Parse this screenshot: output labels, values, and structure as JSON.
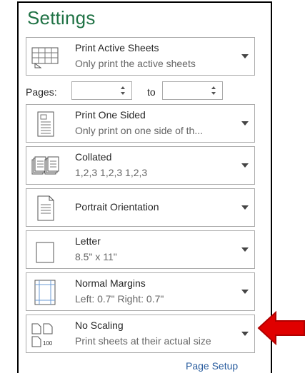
{
  "settings": {
    "title": "Settings",
    "cards": [
      {
        "id": "print-active-sheets",
        "line1": "Print Active Sheets",
        "line2": "Only print the active sheets"
      },
      {
        "id": "print-one-sided",
        "line1": "Print One Sided",
        "line2": "Only print on one side of th..."
      },
      {
        "id": "collated",
        "line1": "Collated",
        "line2": "1,2,3   1,2,3   1,2,3"
      },
      {
        "id": "portrait-orientation",
        "line1": "Portrait Orientation"
      },
      {
        "id": "letter",
        "line1": "Letter",
        "line2": "8.5\" x 11\""
      },
      {
        "id": "normal-margins",
        "line1": "Normal Margins",
        "line2": "Left:  0.7\"    Right:  0.7\""
      },
      {
        "id": "no-scaling",
        "line1": "No Scaling",
        "line2": "Print sheets at their actual size"
      }
    ],
    "pages_label": "Pages:",
    "to_label": "to",
    "pages_from": "",
    "pages_to": "",
    "page_setup_link": "Page Setup"
  },
  "colors": {
    "title": "#217346",
    "link": "#2a5d9f",
    "annotation_arrow": "#e00000"
  },
  "icons": [
    "sheet-grid-icon",
    "one-sided-page-icon",
    "collated-pages-icon",
    "portrait-page-icon",
    "letter-page-icon",
    "margins-page-icon",
    "scaling-100-icon"
  ]
}
